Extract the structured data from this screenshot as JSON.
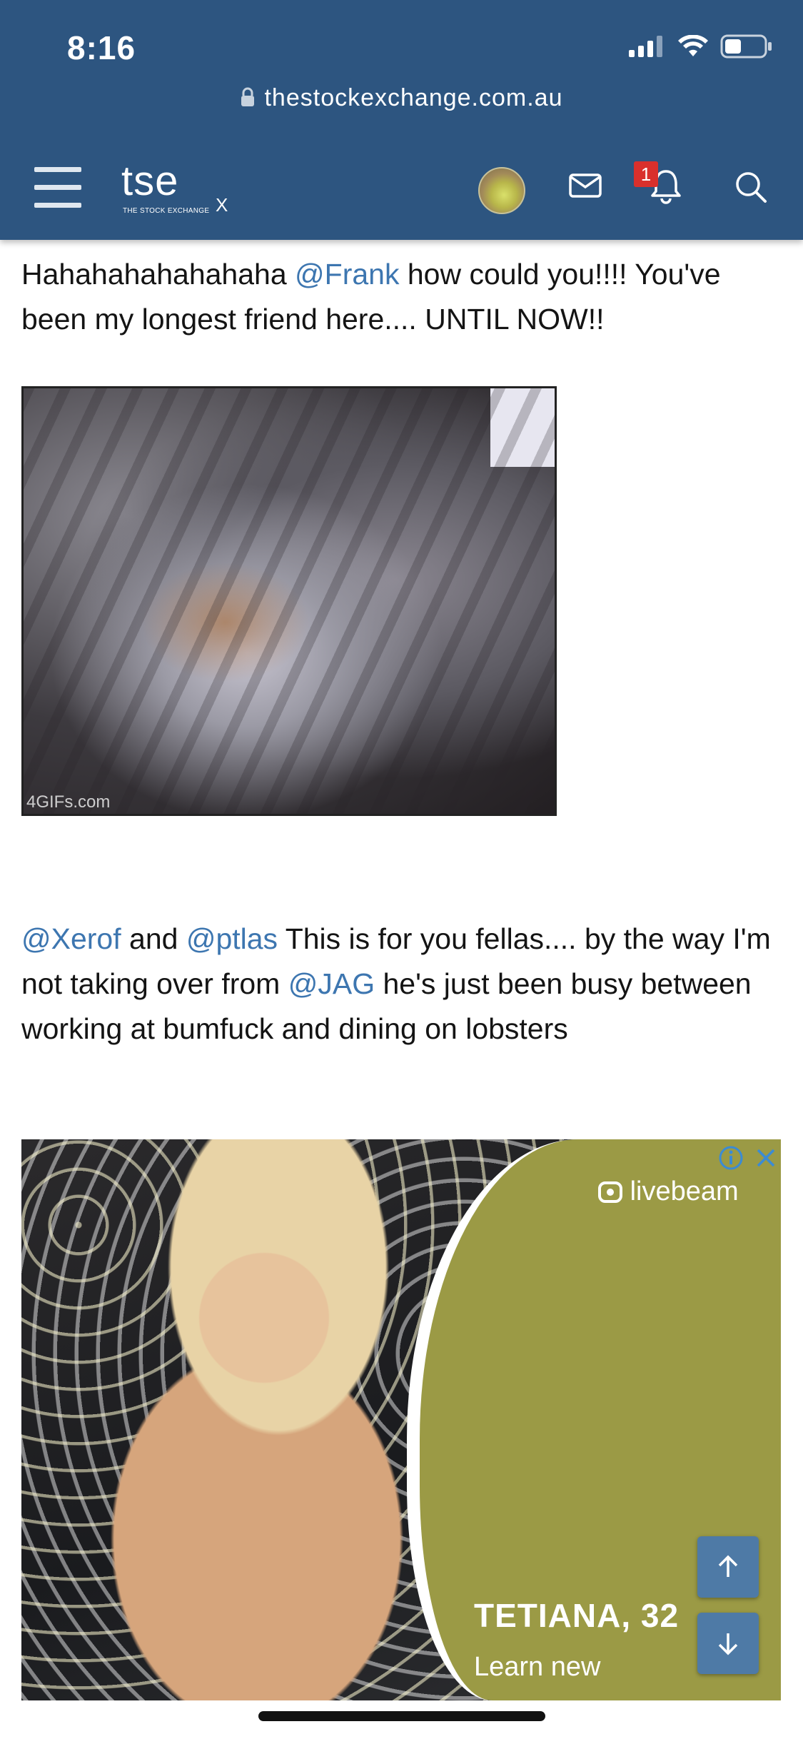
{
  "status_bar": {
    "time": "8:16"
  },
  "browser": {
    "url": "thestockexchange.com.au"
  },
  "navbar": {
    "logo_text": "tse",
    "logo_subtext": "THE STOCK EXCHANGE",
    "logo_mark": "X",
    "notification_count": "1",
    "icons": [
      "menu-icon",
      "avatar",
      "mail-icon",
      "bell-icon",
      "search-icon"
    ]
  },
  "post1": {
    "before": "Hahahahahahahaha ",
    "mention": "@Frank",
    "after": " how could you!!!! You've been my longest friend here.... UNTIL NOW!!"
  },
  "gif": {
    "watermark": "4GIFs.com"
  },
  "post2": {
    "mention1": "@Xerof",
    "and": " and ",
    "mention2": "@ptlas",
    "mid": " This is for you fellas.... by the way I'm not taking over from ",
    "mention3": "@JAG",
    "end": " he's just been busy between working at bumfuck and dining on lobsters"
  },
  "ad": {
    "brand": "livebeam",
    "name": "TETIANA, 32",
    "cta": "Learn new"
  },
  "colors": {
    "header": "#2d5580",
    "link": "#3d76b0",
    "badge": "#d9302c",
    "ad_panel": "#9b9a45"
  }
}
